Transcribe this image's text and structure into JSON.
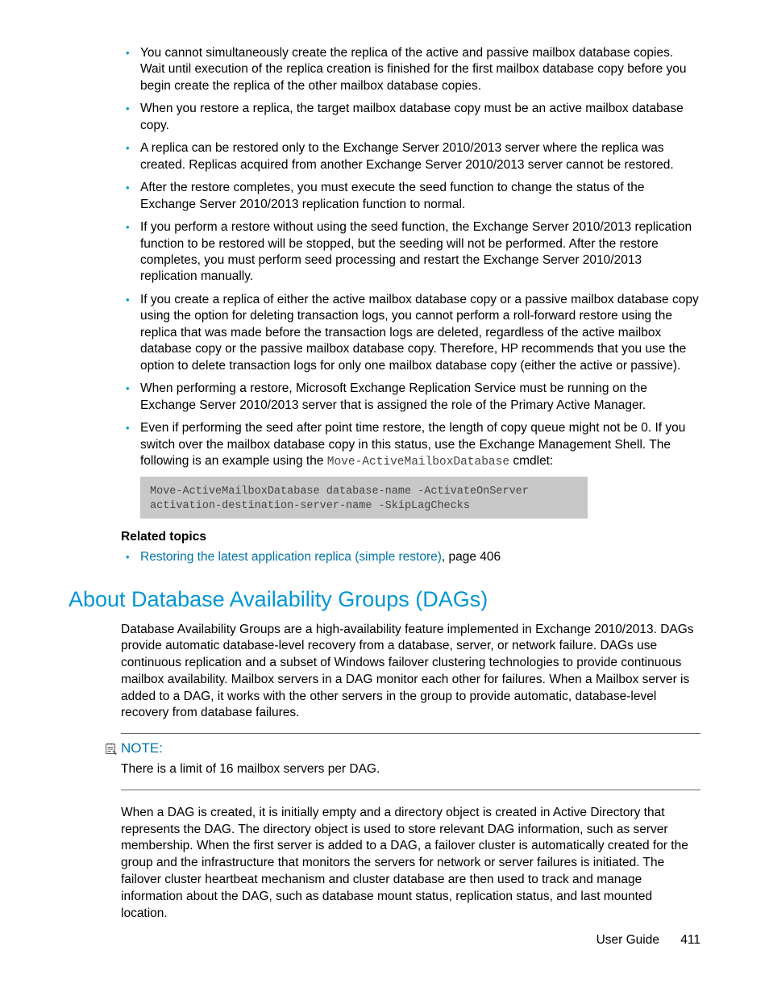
{
  "bullets": [
    "You cannot simultaneously create the replica of the active and passive mailbox database copies. Wait until execution of the replica creation is finished for the first mailbox database copy before you begin create the replica of the other mailbox database copies.",
    "When you restore a replica, the target mailbox database copy must be an active mailbox database copy.",
    "A replica can be restored only to the Exchange Server 2010/2013 server where the replica was created. Replicas acquired from another Exchange Server 2010/2013 server cannot be restored.",
    "After the restore completes, you must execute the seed function to change the status of the Exchange Server 2010/2013 replication function to normal.",
    "If you perform a restore without using the seed function, the Exchange Server 2010/2013 replication function to be restored will be stopped, but the seeding will not be performed. After the restore completes, you must perform seed processing and restart the Exchange Server 2010/2013 replication manually.",
    "If you create a replica of either the active mailbox database copy or a passive mailbox database copy using the option for deleting transaction logs, you cannot perform a roll-forward restore using the replica that was made before the transaction logs are deleted, regardless of the active mailbox database copy or the passive mailbox database copy. Therefore, HP recommends that you use the option to delete transaction logs for only one mailbox database copy (either the active or passive).",
    "When performing a restore, Microsoft Exchange Replication Service must be running on the Exchange Server 2010/2013 server that is assigned the role of the Primary Active Manager."
  ],
  "bullet8": {
    "pre": "Even if performing the seed after point time restore, the length of copy queue might not be 0. If you switch over the mailbox database copy in this status, use the Exchange Management Shell. The following is an example using the ",
    "code_inline": "Move-ActiveMailboxDatabase",
    "post": " cmdlet:"
  },
  "code_block": "Move-ActiveMailboxDatabase database-name -ActivateOnServer\nactivation-destination-server-name -SkipLagChecks",
  "related": {
    "heading": "Related topics",
    "link_text": "Restoring the latest application replica (simple restore)",
    "link_suffix": ", page 406"
  },
  "section_heading": "About Database Availability Groups (DAGs)",
  "para1": "Database Availability Groups are a high-availability feature implemented in Exchange 2010/2013. DAGs provide automatic database-level recovery from a database, server, or network failure. DAGs use continuous replication and a subset of Windows failover clustering technologies to provide continuous mailbox availability. Mailbox servers in a DAG monitor each other for failures. When a Mailbox server is added to a DAG, it works with the other servers in the group to provide automatic, database-level recovery from database failures.",
  "note": {
    "label": "NOTE:",
    "body": "There is a limit of 16 mailbox servers per DAG."
  },
  "para2": "When a DAG is created, it is initially empty and a directory object is created in Active Directory that represents the DAG. The directory object is used to store relevant DAG information, such as server membership. When the first server is added to a DAG, a failover cluster is automatically created for the group and the infrastructure that monitors the servers for network or server failures is initiated. The failover cluster heartbeat mechanism and cluster database are then used to track and manage information about the DAG, such as database mount status, replication status, and last mounted location.",
  "footer": {
    "doc": "User Guide",
    "page": "411"
  }
}
